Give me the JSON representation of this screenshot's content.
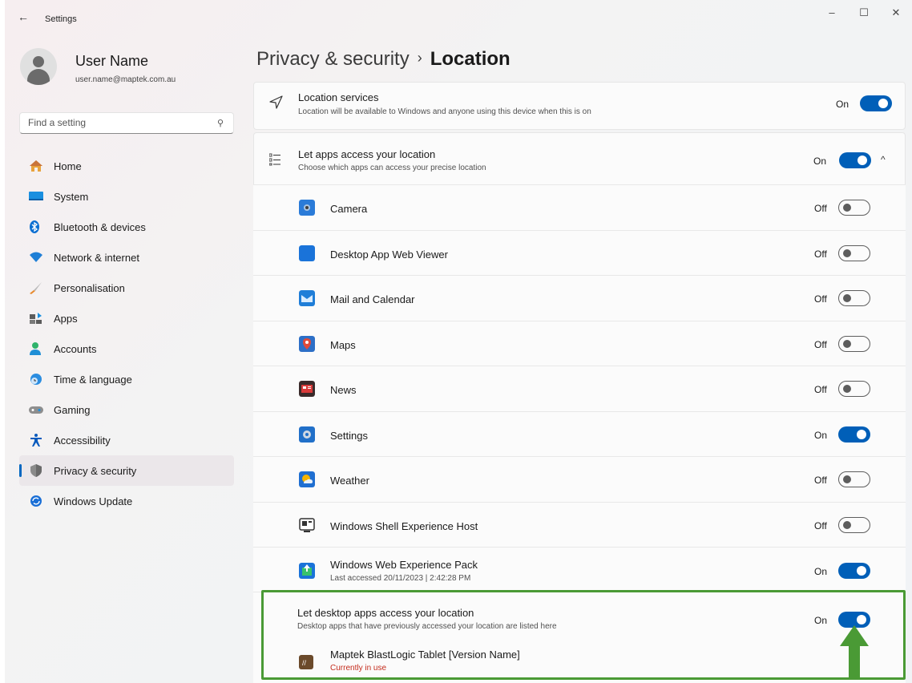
{
  "window": {
    "title": "Settings",
    "back_glyph": "←",
    "minimize_glyph": "–",
    "maximize_glyph": "☐",
    "close_glyph": "✕"
  },
  "user": {
    "name": "User Name",
    "email": "user.name@maptek.com.au"
  },
  "search": {
    "placeholder": "Find a setting",
    "icon": "search-icon"
  },
  "sidebar": {
    "items": [
      {
        "label": "Home",
        "icon": "home-icon",
        "active": false
      },
      {
        "label": "System",
        "icon": "system-icon",
        "active": false
      },
      {
        "label": "Bluetooth & devices",
        "icon": "bluetooth-icon",
        "active": false
      },
      {
        "label": "Network & internet",
        "icon": "network-icon",
        "active": false
      },
      {
        "label": "Personalisation",
        "icon": "brush-icon",
        "active": false
      },
      {
        "label": "Apps",
        "icon": "apps-icon",
        "active": false
      },
      {
        "label": "Accounts",
        "icon": "accounts-icon",
        "active": false
      },
      {
        "label": "Time & language",
        "icon": "globe-clock-icon",
        "active": false
      },
      {
        "label": "Gaming",
        "icon": "gamepad-icon",
        "active": false
      },
      {
        "label": "Accessibility",
        "icon": "accessibility-icon",
        "active": false
      },
      {
        "label": "Privacy & security",
        "icon": "shield-icon",
        "active": true
      },
      {
        "label": "Windows Update",
        "icon": "update-icon",
        "active": false
      }
    ]
  },
  "header": {
    "parent": "Privacy & security",
    "separator": "›",
    "current": "Location"
  },
  "location_services": {
    "title": "Location services",
    "subtitle": "Location will be available to Windows and anyone using this device when this is on",
    "state": "On"
  },
  "apps_access": {
    "title": "Let apps access your location",
    "subtitle": "Choose which apps can access your precise location",
    "state": "On",
    "expand_glyph": "^"
  },
  "apps": [
    {
      "name": "Camera",
      "state": "Off",
      "sub": ""
    },
    {
      "name": "Desktop App Web Viewer",
      "state": "Off",
      "sub": ""
    },
    {
      "name": "Mail and Calendar",
      "state": "Off",
      "sub": ""
    },
    {
      "name": "Maps",
      "state": "Off",
      "sub": ""
    },
    {
      "name": "News",
      "state": "Off",
      "sub": ""
    },
    {
      "name": "Settings",
      "state": "On",
      "sub": ""
    },
    {
      "name": "Weather",
      "state": "Off",
      "sub": ""
    },
    {
      "name": "Windows Shell Experience Host",
      "state": "Off",
      "sub": ""
    },
    {
      "name": "Windows Web Experience Pack",
      "state": "On",
      "sub": "Last accessed 20/11/2023  |  2:42:28 PM"
    }
  ],
  "desktop_apps": {
    "title": "Let desktop apps access your location",
    "subtitle": "Desktop apps that have previously accessed your location are listed here",
    "state": "On",
    "app_name": "Maptek BlastLogic Tablet  [Version Name]",
    "app_status": "Currently in use"
  },
  "colors": {
    "accent": "#005fb8",
    "highlight": "#4a9a35",
    "in_use": "#c42b1c"
  }
}
